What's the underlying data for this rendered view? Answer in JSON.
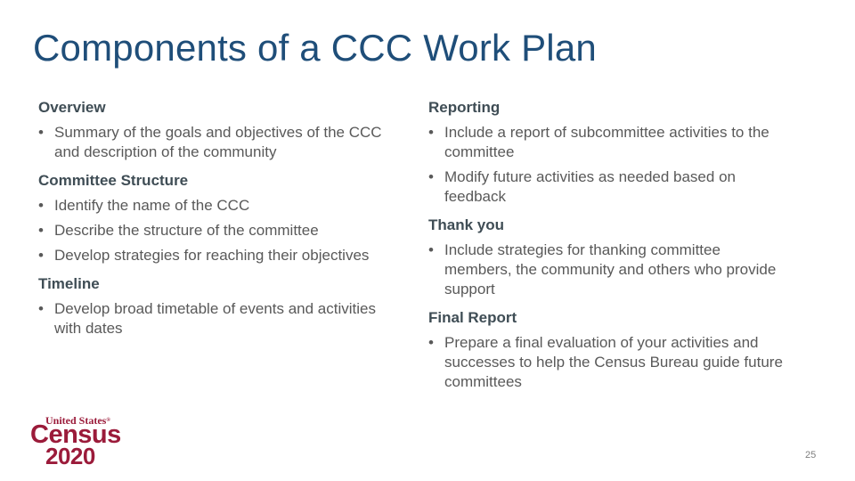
{
  "slide": {
    "title": "Components of a CCC Work Plan",
    "page_number": "25"
  },
  "left_column": {
    "sections": [
      {
        "heading": "Overview",
        "bullets": [
          "Summary of the goals and objectives of the CCC and description of the community"
        ]
      },
      {
        "heading": "Committee Structure",
        "bullets": [
          "Identify the name of the CCC",
          "Describe the structure of the committee",
          "Develop strategies for reaching their objectives"
        ]
      },
      {
        "heading": "Timeline",
        "bullets": [
          "Develop broad timetable of events and activities with dates"
        ]
      }
    ]
  },
  "right_column": {
    "sections": [
      {
        "heading": "Reporting",
        "bullets": [
          "Include a report of subcommittee activities to the committee",
          "Modify future activities as needed based on feedback"
        ]
      },
      {
        "heading": "Thank you",
        "bullets": [
          "Include strategies for thanking committee members, the community and others who provide support"
        ]
      },
      {
        "heading": "Final Report",
        "bullets": [
          "Prepare a final evaluation of your activities and successes to help the Census Bureau guide future committees"
        ]
      }
    ]
  },
  "logo": {
    "line1": "United States",
    "registered_mark": "®",
    "line2": "Census",
    "line3": "2020"
  },
  "bullet_glyph": "•",
  "colors": {
    "title": "#1f4e79",
    "heading": "#3f4d55",
    "body": "#595959",
    "logo": "#9b1b3a"
  }
}
